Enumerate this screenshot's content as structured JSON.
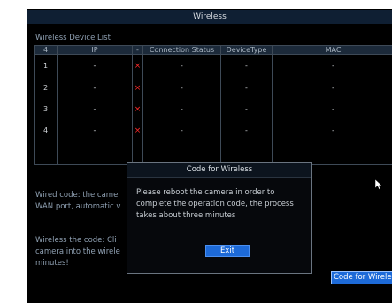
{
  "window": {
    "title": "Wireless"
  },
  "device_list": {
    "label": "Wireless Device List",
    "columns": [
      "4",
      "IP",
      "-",
      "Connection Status",
      "DeviceType",
      "MAC"
    ],
    "rows": [
      {
        "num": "1",
        "ip": "-",
        "status_icon": "x-icon",
        "connection_status": "-",
        "device_type": "-",
        "mac": "-"
      },
      {
        "num": "2",
        "ip": "-",
        "status_icon": "x-icon",
        "connection_status": "-",
        "device_type": "-",
        "mac": "-"
      },
      {
        "num": "3",
        "ip": "-",
        "status_icon": "x-icon",
        "connection_status": "-",
        "device_type": "-",
        "mac": "-"
      },
      {
        "num": "4",
        "ip": "-",
        "status_icon": "x-icon",
        "connection_status": "-",
        "device_type": "-",
        "mac": "-"
      }
    ],
    "status_mark": "×"
  },
  "wired_code_text": {
    "line1": "Wired code: the came",
    "line2": "WAN port, automatic v"
  },
  "wireless_code_text": {
    "line1": "Wireless the code: Cli",
    "line2": "camera into the wirele",
    "line3": "minutes!"
  },
  "dialog": {
    "title": "Code for Wireless",
    "message_line1": "Please reboot the camera in order to",
    "message_line2": "complete the operation code, the process",
    "message_line3": "takes about three minutes",
    "exit_label": "Exit"
  },
  "code_button_label": "Code for Wireless",
  "colors": {
    "accent": "#1d6ad8",
    "error": "#ff2a2a"
  }
}
